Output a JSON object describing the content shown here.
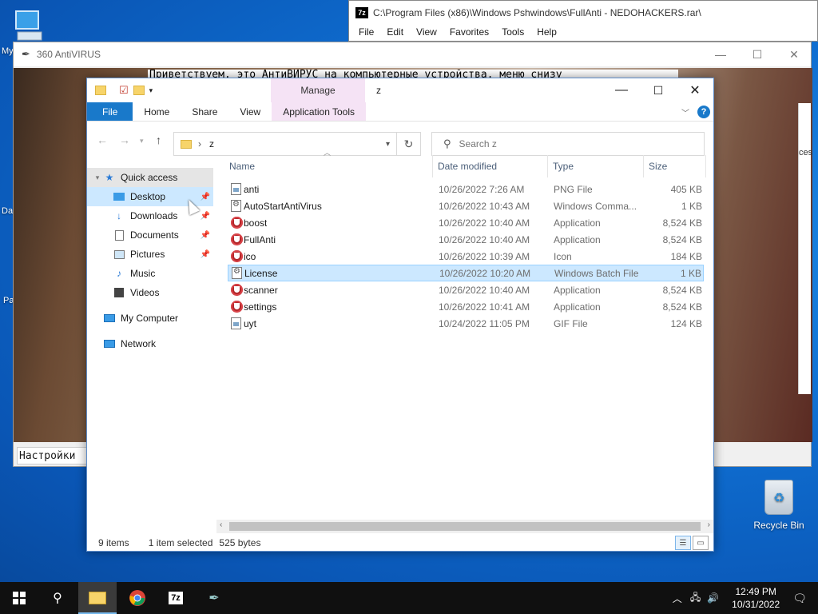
{
  "desktop": {
    "left_labels": [
      "My",
      "Da",
      "Pa"
    ],
    "recycle_bin": "Recycle Bin"
  },
  "window_7z": {
    "title": "C:\\Program Files (x86)\\Windows Pshwindows\\FullAnti - NEDOHACKERS.rar\\",
    "menu": [
      "File",
      "Edit",
      "View",
      "Favorites",
      "Tools",
      "Help"
    ]
  },
  "window_360": {
    "title": "360 AntiVIRUS",
    "greeting": "Приветствуем, это АнтиВИРУС на компьютерные устройства, меню снизу",
    "settings_label": "Настройки",
    "side_text": "ces"
  },
  "explorer": {
    "manage_label": "Manage",
    "window_title": "z",
    "ribbon_tabs": [
      "File",
      "Home",
      "Share",
      "View",
      "Application Tools"
    ],
    "address_crumb": "z",
    "search_placeholder": "Search z",
    "columns": [
      "Name",
      "Date modified",
      "Type",
      "Size"
    ],
    "sidebar": {
      "quick_access": "Quick access",
      "items": [
        "Desktop",
        "Downloads",
        "Documents",
        "Pictures",
        "Music",
        "Videos"
      ],
      "my_computer": "My Computer",
      "network": "Network"
    },
    "files": [
      {
        "name": "anti",
        "date": "10/26/2022 7:26 AM",
        "type": "PNG File",
        "size": "405 KB",
        "icon": "image"
      },
      {
        "name": "AutoStartAntiVirus",
        "date": "10/26/2022 10:43 AM",
        "type": "Windows Comma...",
        "size": "1 KB",
        "icon": "batch"
      },
      {
        "name": "boost",
        "date": "10/26/2022 10:40 AM",
        "type": "Application",
        "size": "8,524 KB",
        "icon": "app"
      },
      {
        "name": "FullAnti",
        "date": "10/26/2022 10:40 AM",
        "type": "Application",
        "size": "8,524 KB",
        "icon": "app"
      },
      {
        "name": "ico",
        "date": "10/26/2022 10:39 AM",
        "type": "Icon",
        "size": "184 KB",
        "icon": "app"
      },
      {
        "name": "License",
        "date": "10/26/2022 10:20 AM",
        "type": "Windows Batch File",
        "size": "1 KB",
        "icon": "batch",
        "selected": true
      },
      {
        "name": "scanner",
        "date": "10/26/2022 10:40 AM",
        "type": "Application",
        "size": "8,524 KB",
        "icon": "app"
      },
      {
        "name": "settings",
        "date": "10/26/2022 10:41 AM",
        "type": "Application",
        "size": "8,524 KB",
        "icon": "app"
      },
      {
        "name": "uyt",
        "date": "10/24/2022 11:05 PM",
        "type": "GIF File",
        "size": "124 KB",
        "icon": "image"
      }
    ],
    "status": {
      "items": "9 items",
      "selected": "1 item selected",
      "bytes": "525 bytes"
    }
  },
  "taskbar": {
    "time": "12:49 PM",
    "date": "10/31/2022",
    "apps": [
      "start-icon",
      "search-icon",
      "file-explorer-icon",
      "chrome-icon",
      "7zip-icon",
      "feather-icon"
    ]
  }
}
